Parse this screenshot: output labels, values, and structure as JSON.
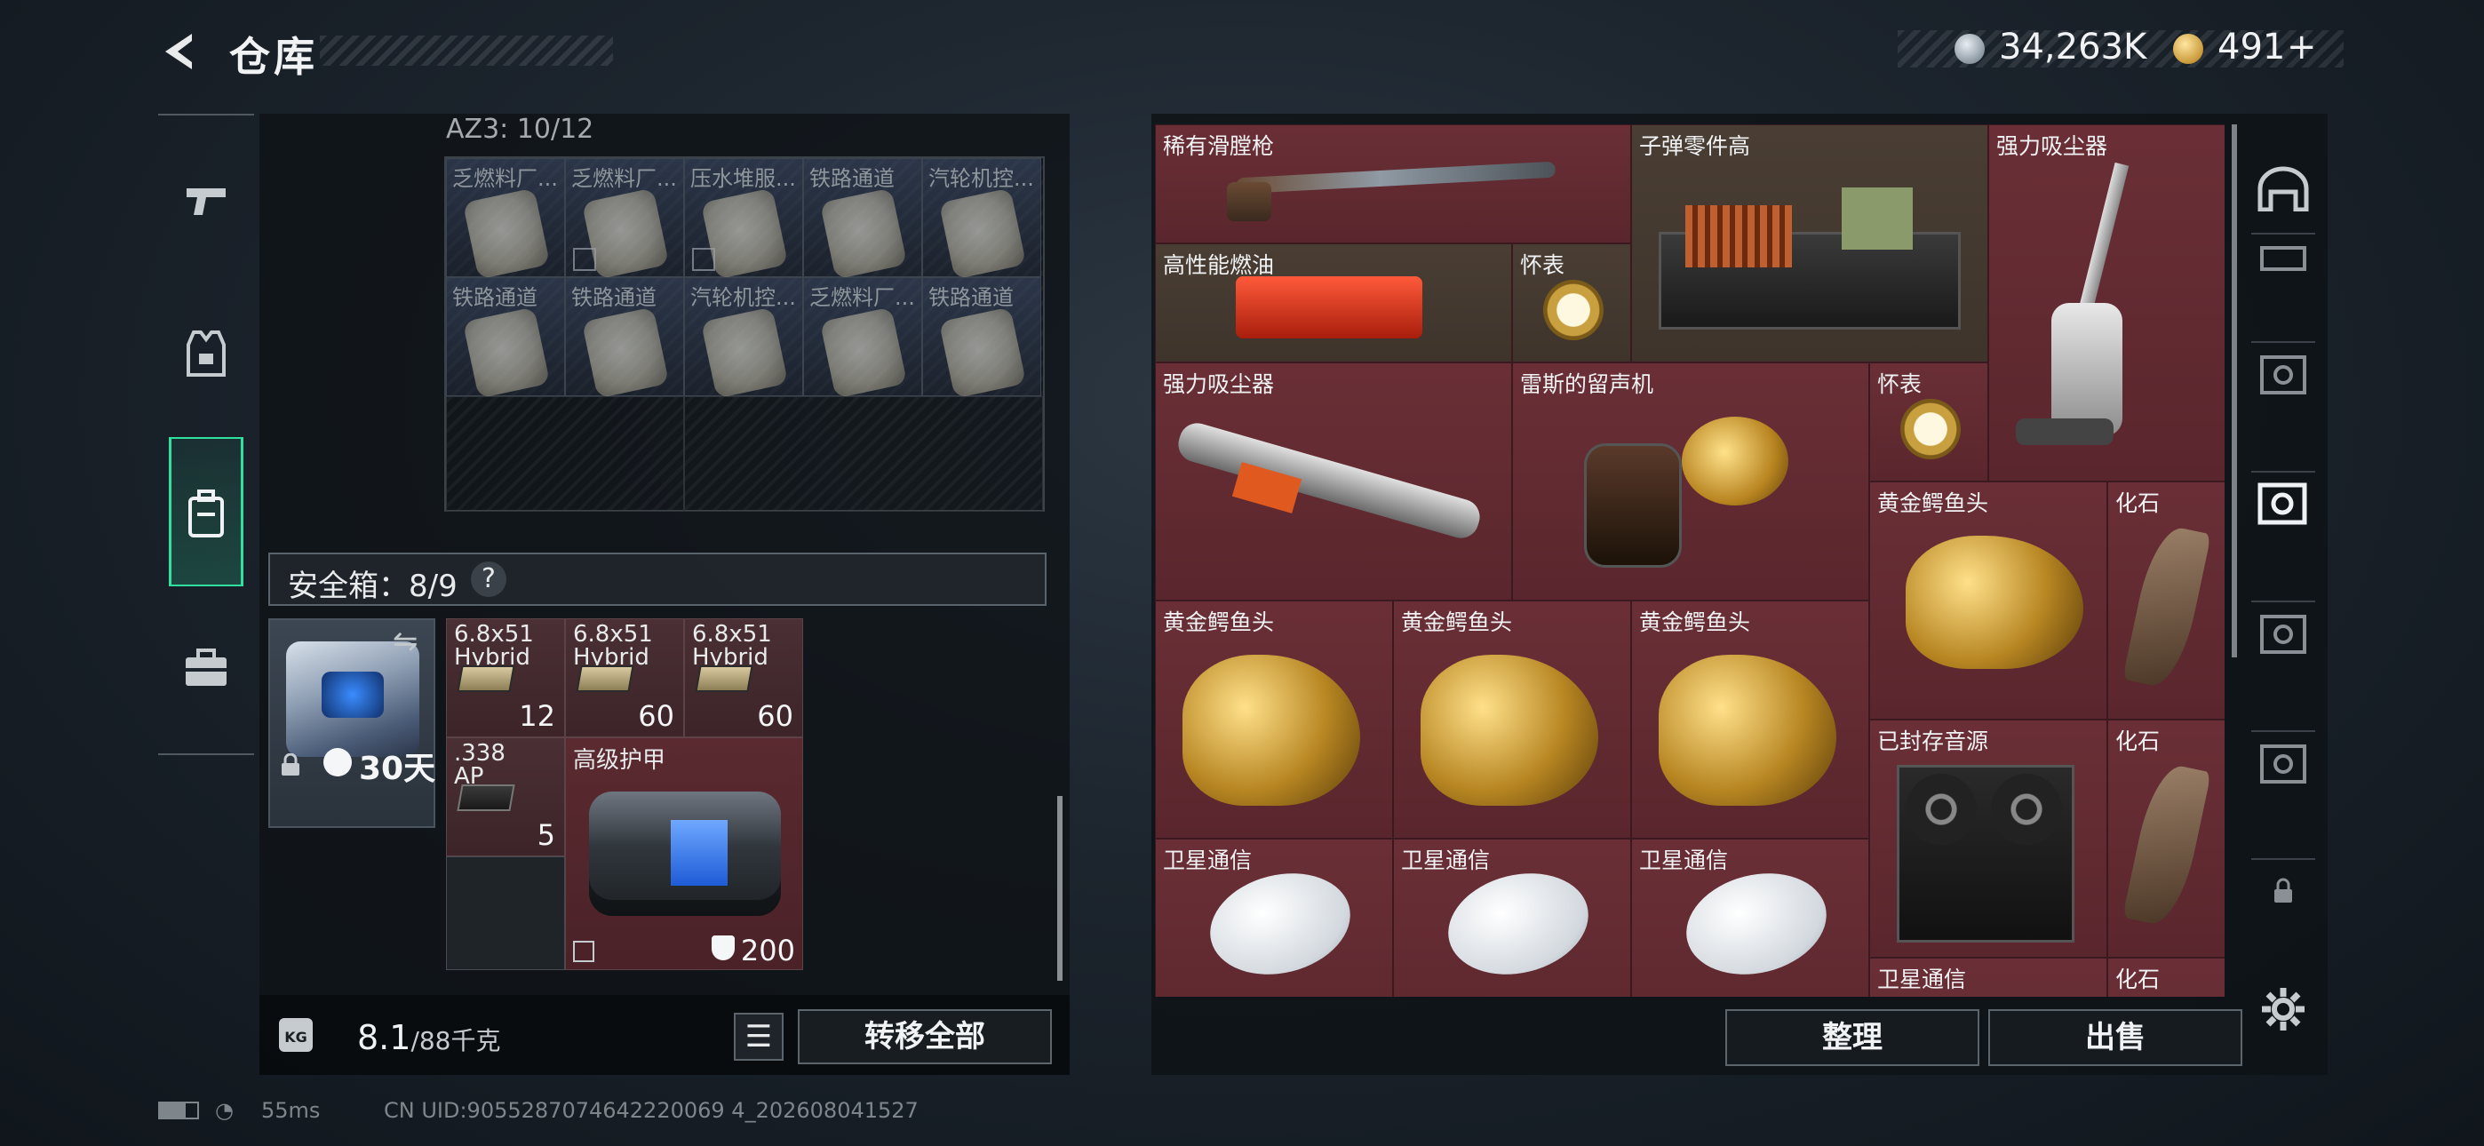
{
  "header": {
    "title": "仓库",
    "stripe": true
  },
  "currency": {
    "silver": {
      "value": "34,263K",
      "icon": "silver-coin-icon"
    },
    "gold": {
      "value": "491",
      "plus": "+",
      "icon": "gold-coin-icon"
    }
  },
  "left_nav": [
    {
      "name": "weapon",
      "icon": "pistol-icon"
    },
    {
      "name": "gear",
      "icon": "vest-icon"
    },
    {
      "name": "backpack",
      "icon": "backpack-icon",
      "active": true
    },
    {
      "name": "case",
      "icon": "briefcase-icon"
    }
  ],
  "container": {
    "label": "AZ3: 10/12",
    "cells": [
      {
        "label": "乏燃料厂...",
        "marked": false
      },
      {
        "label": "乏燃料厂...",
        "marked": true
      },
      {
        "label": "压水堆服...",
        "marked": true
      },
      {
        "label": "铁路通道",
        "marked": false
      },
      {
        "label": "汽轮机控...",
        "marked": false
      },
      {
        "label": "铁路通道",
        "marked": false
      },
      {
        "label": "铁路通道",
        "marked": false
      },
      {
        "label": "汽轮机控...",
        "marked": false
      },
      {
        "label": "乏燃料厂...",
        "marked": false
      },
      {
        "label": "铁路通道",
        "marked": false
      }
    ]
  },
  "safe_box": {
    "title": "安全箱：8/9",
    "help": "?",
    "duration": "30天",
    "ammo": [
      {
        "caliber": "6.8x51",
        "type": "Hybrid",
        "count": "12"
      },
      {
        "caliber": "6.8x51",
        "type": "Hybrid",
        "count": "60"
      },
      {
        "caliber": "6.8x51",
        "type": "Hybrid",
        "count": "60"
      }
    ],
    "ammo2": {
      "caliber": ".338",
      "type": "AP",
      "count": "5"
    },
    "armor": {
      "name": "高级护甲",
      "durability": "200"
    }
  },
  "weight": {
    "current": "8.1",
    "max": "/88千克",
    "unit_icon": "KG"
  },
  "buttons": {
    "transfer_all": "转移全部",
    "organize": "整理",
    "sell": "出售"
  },
  "stash_items": [
    {
      "name": "稀有滑膛枪"
    },
    {
      "name": "子弹零件高"
    },
    {
      "name": "强力吸尘器"
    },
    {
      "name": "高性能燃油"
    },
    {
      "name": "怀表"
    },
    {
      "name": "强力吸尘器"
    },
    {
      "name": "雷斯的留声机"
    },
    {
      "name": "怀表"
    },
    {
      "name": "黄金鳄鱼头"
    },
    {
      "name": "化石"
    },
    {
      "name": "黄金鳄鱼头"
    },
    {
      "name": "黄金鳄鱼头"
    },
    {
      "name": "黄金鳄鱼头"
    },
    {
      "name": "已封存音源"
    },
    {
      "name": "化石"
    },
    {
      "name": "卫星通信"
    },
    {
      "name": "卫星通信"
    },
    {
      "name": "卫星通信"
    },
    {
      "name": "卫星通信"
    },
    {
      "name": "化石"
    }
  ],
  "footer": {
    "ping": "55ms",
    "uid": "CN UID:9055287074642220069 4_202608041527"
  },
  "colors": {
    "accent": "#2fe0a0",
    "item_bg": "#5c2a31"
  }
}
